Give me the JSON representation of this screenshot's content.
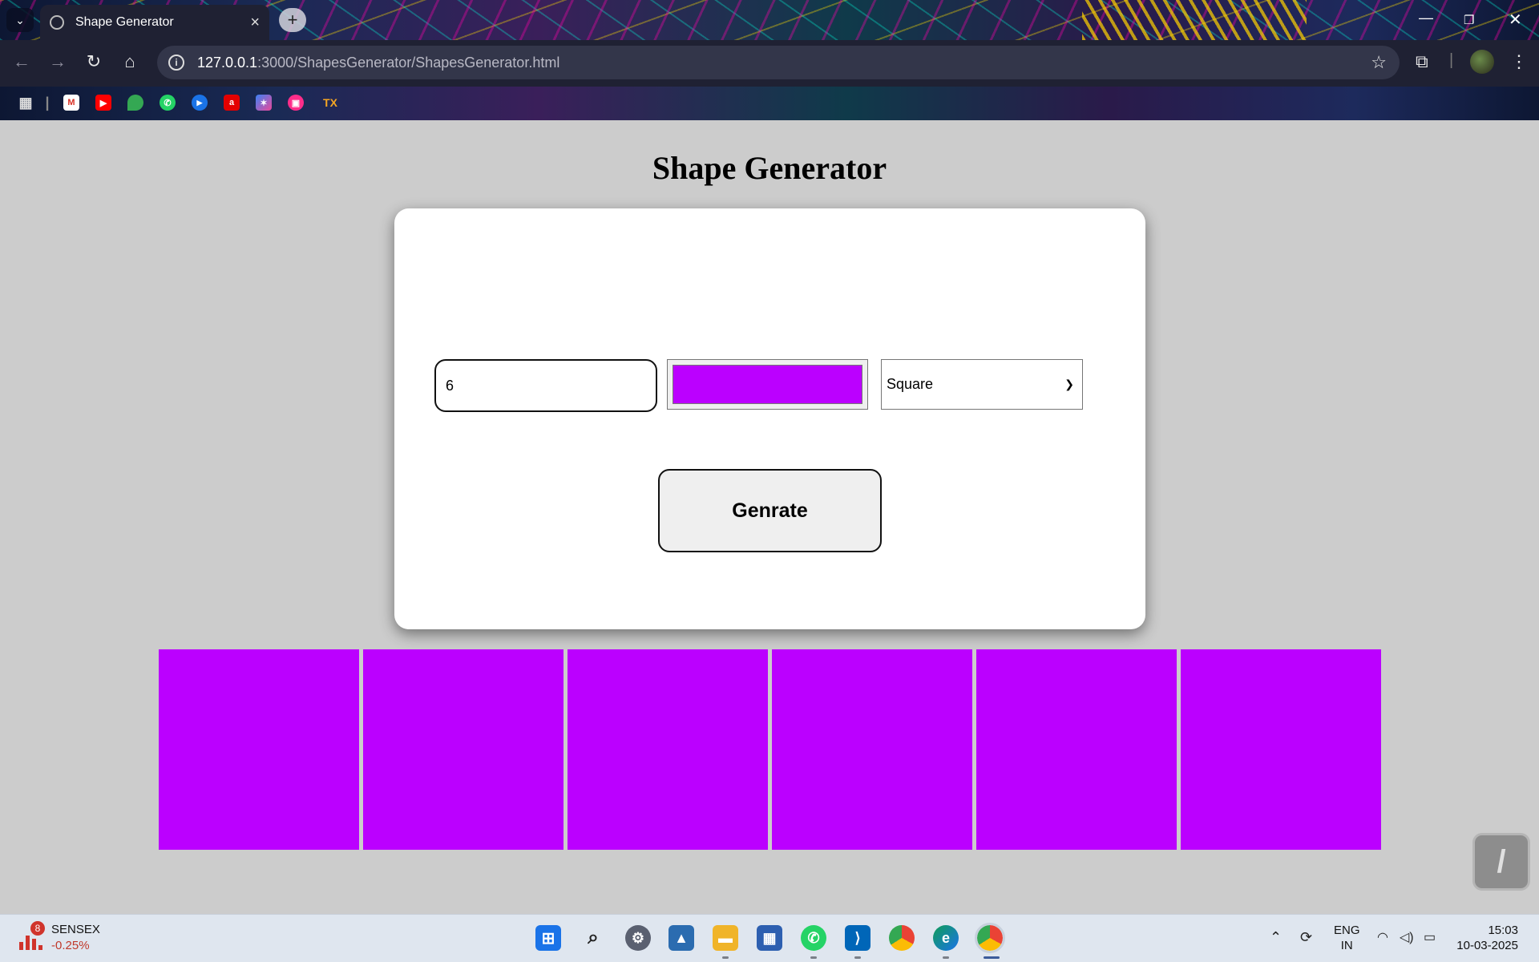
{
  "browser": {
    "tab_title": "Shape Generator",
    "url_host": "127.0.0.1",
    "url_path": ":3000/ShapesGenerator/ShapesGenerator.html",
    "bookmarks": [
      "apps",
      "gmail",
      "youtube",
      "maps",
      "whatsapp",
      "video",
      "airtel",
      "app",
      "store",
      "TX"
    ]
  },
  "page": {
    "title": "Shape Generator",
    "count_value": "6",
    "color_value": "#bb00ff",
    "shape_selected": "Square",
    "generate_label": "Genrate"
  },
  "shapes": {
    "count": 6,
    "type": "Square",
    "color": "#bb00ff"
  },
  "taskbar": {
    "stock_name": "SENSEX",
    "stock_change": "-0.25%",
    "notification_count": "8",
    "lang_line1": "ENG",
    "lang_line2": "IN",
    "time": "15:03",
    "date": "10-03-2025"
  }
}
